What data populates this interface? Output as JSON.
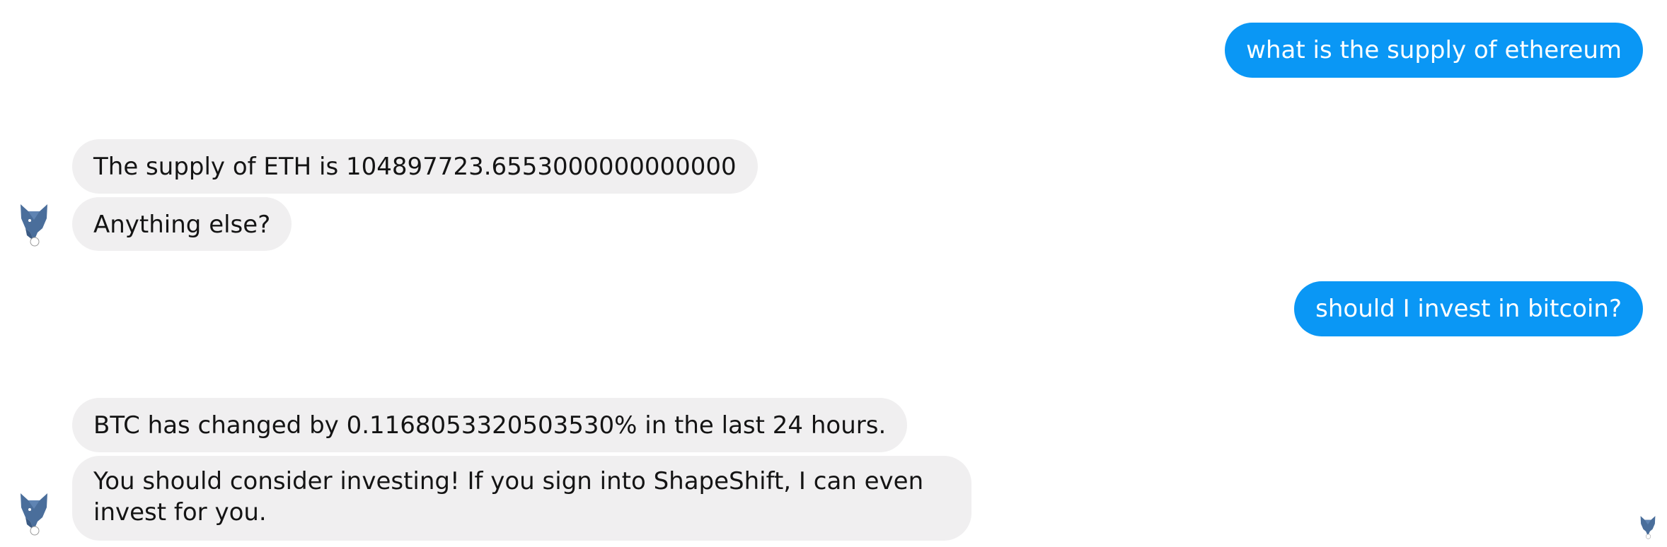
{
  "messages": {
    "user_1": "what is the supply of ethereum",
    "bot_1a": "The supply of ETH is 104897723.6553000000000000",
    "bot_1b": "Anything else?",
    "user_2": "should I invest in bitcoin?",
    "bot_2a": "BTC has changed by 0.1168053320503530% in the last 24 hours.",
    "bot_2b": "You should consider investing! If you sign into ShapeShift, I can even invest for you."
  },
  "icons": {
    "bot_avatar": "fox-icon",
    "seen_indicator": "fox-icon"
  },
  "colors": {
    "outgoing_bubble": "#0a97f5",
    "incoming_bubble": "#f0eff0",
    "avatar_fox": "#4a6e9b"
  }
}
